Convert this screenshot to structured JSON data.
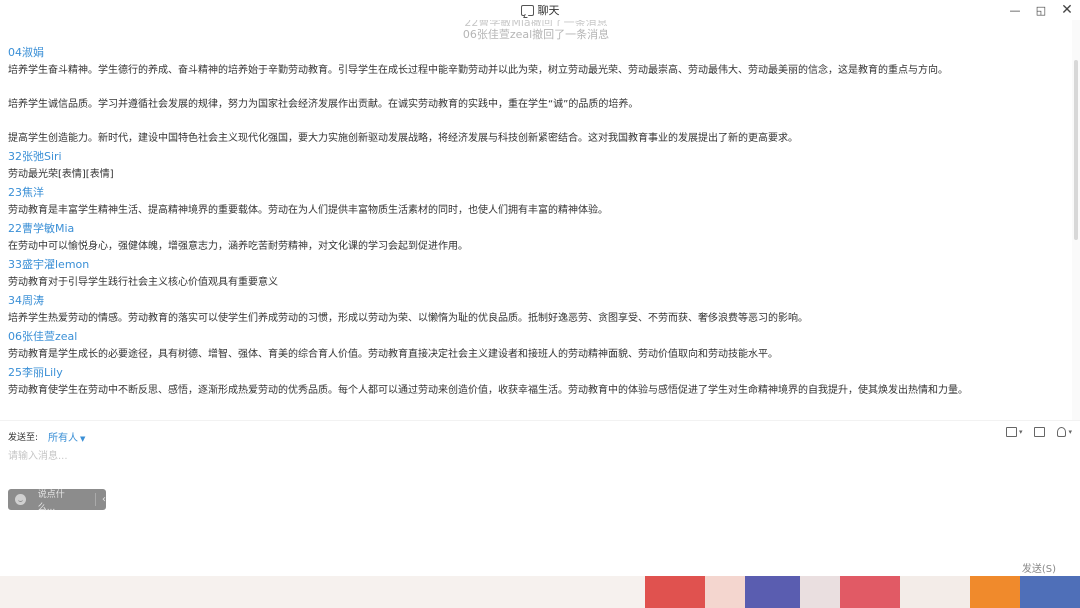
{
  "window": {
    "title": "聊天",
    "controls": [
      "—",
      "◱",
      "✕"
    ]
  },
  "notices": [
    "22曹学敏Mia撤回了一条消息",
    "06张佳萱zeal撤回了一条消息"
  ],
  "messages": [
    {
      "sender": "04淑娟",
      "lines": [
        "培养学生奋斗精神。学生德行的养成、奋斗精神的培养始于辛勤劳动教育。引导学生在成长过程中能辛勤劳动并以此为荣，树立劳动最光荣、劳动最崇高、劳动最伟大、劳动最美丽的信念，这是教育的重点与方向。",
        "培养学生诚信品质。学习并遵循社会发展的规律，努力为国家社会经济发展作出贡献。在诚实劳动教育的实践中，重在学生“诚”的品质的培养。",
        "提高学生创造能力。新时代，建设中国特色社会主义现代化强国，要大力实施创新驱动发展战略，将经济发展与科技创新紧密结合。这对我国教育事业的发展提出了新的更高要求。"
      ]
    },
    {
      "sender": "32张弛Siri",
      "lines": [
        "劳动最光荣[表情][表情]"
      ]
    },
    {
      "sender": "23焦洋",
      "lines": [
        "劳动教育是丰富学生精神生活、提高精神境界的重要载体。劳动在为人们提供丰富物质生活素材的同时，也使人们拥有丰富的精神体验。"
      ]
    },
    {
      "sender": "22曹学敏Mia",
      "lines": [
        "在劳动中可以愉悦身心，强健体魄，增强意志力，涵养吃苦耐劳精神，对文化课的学习会起到促进作用。"
      ]
    },
    {
      "sender": "33盛宇濯lemon",
      "lines": [
        "劳动教育对于引导学生践行社会主义核心价值观具有重要意义"
      ]
    },
    {
      "sender": "34周涛",
      "lines": [
        "培养学生热爱劳动的情感。劳动教育的落实可以使学生们养成劳动的习惯，形成以劳动为荣、以懒惰为耻的优良品质。抵制好逸恶劳、贪图享受、不劳而获、奢侈浪费等恶习的影响。"
      ]
    },
    {
      "sender": "06张佳萱zeal",
      "lines": [
        "劳动教育是学生成长的必要途径，具有树德、增智、强体、育美的综合育人价值。劳动教育直接决定社会主义建设者和接班人的劳动精神面貌、劳动价值取向和劳动技能水平。"
      ]
    },
    {
      "sender": "25李丽Lily",
      "lines": [
        "劳动教育使学生在劳动中不断反思、感悟，逐渐形成热爱劳动的优秀品质。每个人都可以通过劳动来创造价值，收获幸福生活。劳动教育中的体验与感悟促进了学生对生命精神境界的自我提升，使其焕发出热情和力量。"
      ]
    }
  ],
  "composer": {
    "send_to_label": "发送至:",
    "send_to_target": "所有人",
    "placeholder": "请输入消息...",
    "say_label": "说点什么...",
    "collapse_glyph": "‹",
    "send_label": "发送(S)"
  },
  "colors": {
    "sender_name": "#3a8fd6",
    "notice_text": "#b5b5b5"
  }
}
